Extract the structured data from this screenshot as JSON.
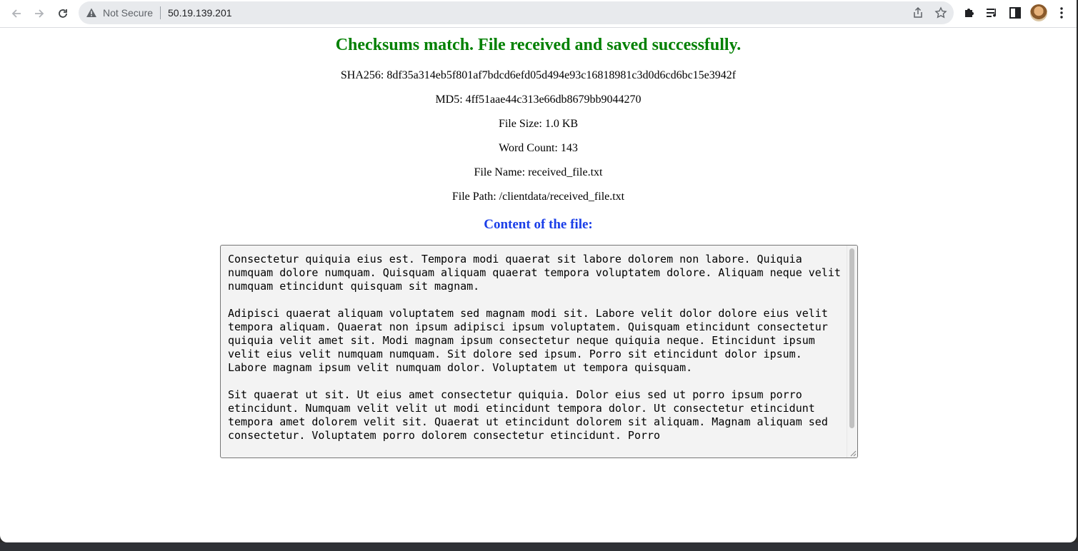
{
  "browser": {
    "security_label": "Not Secure",
    "url": "50.19.139.201",
    "icons": {
      "back": "back-arrow-icon",
      "forward": "forward-arrow-icon",
      "reload": "reload-icon",
      "warning": "warning-triangle-icon",
      "share": "share-icon",
      "bookmark": "star-icon",
      "extensions": "puzzle-icon",
      "media": "media-queue-icon",
      "side_panel": "side-panel-icon",
      "menu": "kebab-menu-icon"
    }
  },
  "page": {
    "headline": "Checksums match. File received and saved successfully.",
    "headline_color": "#008000",
    "sha256": "SHA256: 8df35a314eb5f801af7bdcd6efd05d494e93c16818981c3d0d6cd6bc15e3942f",
    "md5": "MD5: 4ff51aae44c313e66db8679bb9044270",
    "file_size": "File Size: 1.0 KB",
    "word_count": "Word Count: 143",
    "file_name": "File Name: received_file.txt",
    "file_path": "File Path: /clientdata/received_file.txt",
    "content_heading": "Content of the file:",
    "content_heading_color": "#1a3ee8",
    "file_content": "Consectetur quiquia eius est. Tempora modi quaerat sit labore dolorem non labore. Quiquia numquam dolore numquam. Quisquam aliquam quaerat tempora voluptatem dolore. Aliquam neque velit numquam etincidunt quisquam sit magnam.\n\nAdipisci quaerat aliquam voluptatem sed magnam modi sit. Labore velit dolor dolore eius velit tempora aliquam. Quaerat non ipsum adipisci ipsum voluptatem. Quisquam etincidunt consectetur quiquia velit amet sit. Modi magnam ipsum consectetur neque quiquia neque. Etincidunt ipsum velit eius velit numquam numquam. Sit dolore sed ipsum. Porro sit etincidunt dolor ipsum. Labore magnam ipsum velit numquam dolor. Voluptatem ut tempora quisquam.\n\nSit quaerat ut sit. Ut eius amet consectetur quiquia. Dolor eius sed ut porro ipsum porro etincidunt. Numquam velit velit ut modi etincidunt tempora dolor. Ut consectetur etincidunt tempora amet dolorem velit sit. Quaerat ut etincidunt dolorem sit aliquam. Magnam aliquam sed consectetur. Voluptatem porro dolorem consectetur etincidunt. Porro"
  }
}
